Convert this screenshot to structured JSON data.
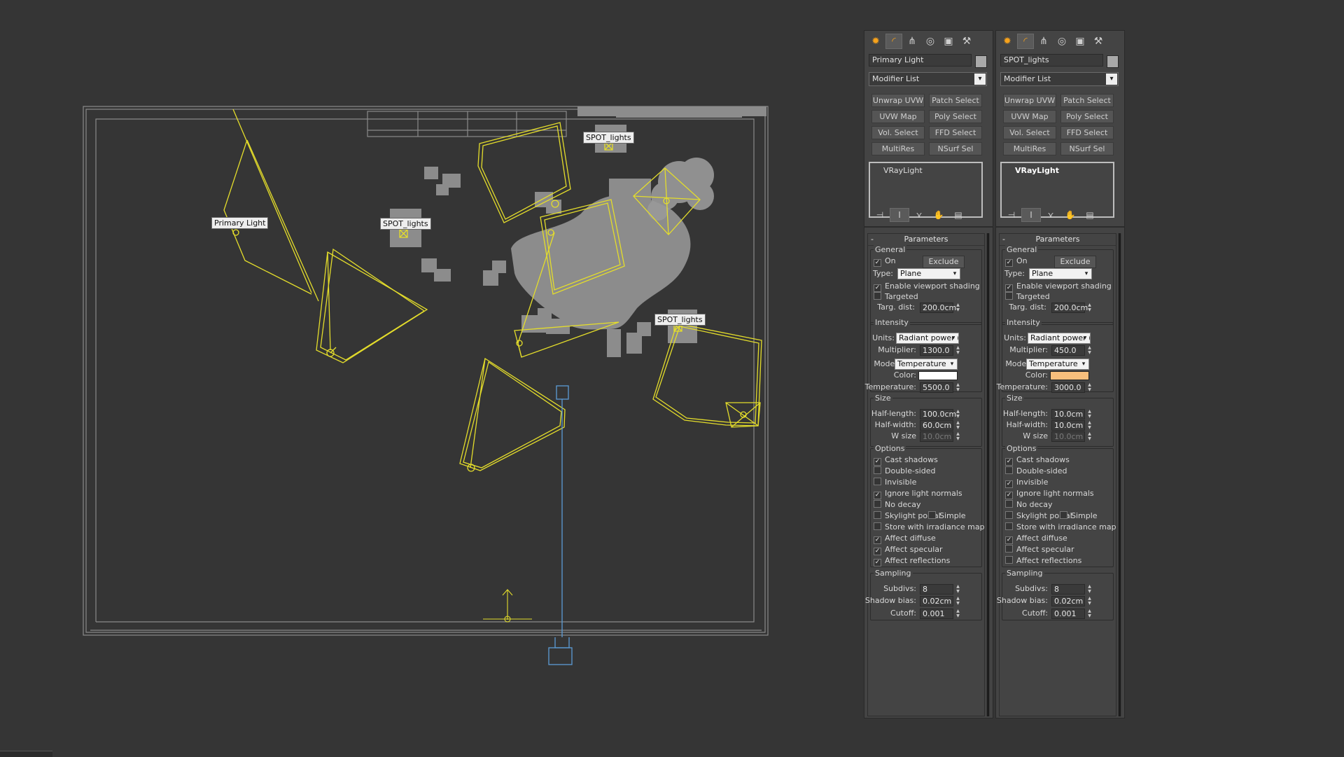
{
  "colors": {
    "background": "#353535",
    "light_wireframe": "#e4dd2b",
    "geometry_fill": "#8c8c8c",
    "camera_line": "#5b9bd5",
    "accent_orange": "#f7a21b"
  },
  "viewport": {
    "labels": {
      "primary_light": "Primary Light",
      "spot_left": "SPOT_lights",
      "spot_top": "SPOT_lights",
      "spot_right": "SPOT_lights"
    }
  },
  "command_tabs": [
    "create-icon",
    "modify-icon",
    "hierarchy-icon",
    "motion-icon",
    "display-icon",
    "utilities-icon"
  ],
  "modifier_buttons": [
    "Unwrap UVW",
    "Patch Select",
    "UVW Map",
    "Poly Select",
    "Vol. Select",
    "FFD Select",
    "MultiRes",
    "NSurf Sel"
  ],
  "panels": [
    {
      "object_name": "Primary Light",
      "modifier_list": "Modifier List",
      "stack_entry": "VRayLight",
      "stack_selected": false,
      "params_title": "Parameters",
      "collapse": "-",
      "general": {
        "title": "General",
        "on_label": "On",
        "on_checked": true,
        "exclude": "Exclude",
        "type_label": "Type:",
        "type_value": "Plane",
        "viewport_shading_label": "Enable viewport shading",
        "viewport_shading": true,
        "targeted_label": "Targeted",
        "targeted": false,
        "targ_dist_label": "Targ. dist:",
        "targ_dist": "200.0cm"
      },
      "intensity": {
        "title": "Intensity",
        "units_label": "Units:",
        "units_value": "Radiant power (W",
        "multiplier_label": "Multiplier:",
        "multiplier": "1300.0",
        "mode_label": "Mode:",
        "mode_value": "Temperature",
        "color_label": "Color:",
        "color": "#ffffff",
        "temperature_label": "Temperature:",
        "temperature": "5500.0"
      },
      "size": {
        "title": "Size",
        "half_length_label": "Half-length:",
        "half_length": "100.0cm",
        "half_width_label": "Half-width:",
        "half_width": "60.0cm",
        "w_size_label": "W size",
        "w_size": "10.0cm"
      },
      "options": {
        "title": "Options",
        "cast_shadows": "Cast shadows",
        "cast_shadows_checked": true,
        "double_sided": "Double-sided",
        "double_sided_checked": false,
        "invisible": "Invisible",
        "invisible_checked": false,
        "ignore_normals": "Ignore light normals",
        "ignore_normals_checked": true,
        "no_decay": "No decay",
        "no_decay_checked": false,
        "skylight_portal": "Skylight portal",
        "skylight_portal_checked": false,
        "simple": "Simple",
        "simple_checked": false,
        "store_irradiance": "Store with irradiance map",
        "store_irradiance_checked": false,
        "affect_diffuse": "Affect diffuse",
        "affect_diffuse_checked": true,
        "affect_specular": "Affect specular",
        "affect_specular_checked": true,
        "affect_reflections": "Affect reflections",
        "affect_reflections_checked": true
      },
      "sampling": {
        "title": "Sampling",
        "subdivs_label": "Subdivs:",
        "subdivs": "8",
        "shadow_bias_label": "Shadow bias:",
        "shadow_bias": "0.02cm",
        "cutoff_label": "Cutoff:",
        "cutoff": "0.001"
      }
    },
    {
      "object_name": "SPOT_lights",
      "modifier_list": "Modifier List",
      "stack_entry": "VRayLight",
      "stack_selected": true,
      "params_title": "Parameters",
      "collapse": "-",
      "general": {
        "title": "General",
        "on_label": "On",
        "on_checked": true,
        "exclude": "Exclude",
        "type_label": "Type:",
        "type_value": "Plane",
        "viewport_shading_label": "Enable viewport shading",
        "viewport_shading": true,
        "targeted_label": "Targeted",
        "targeted": false,
        "targ_dist_label": "Targ. dist:",
        "targ_dist": "200.0cm"
      },
      "intensity": {
        "title": "Intensity",
        "units_label": "Units:",
        "units_value": "Radiant power (W",
        "multiplier_label": "Multiplier:",
        "multiplier": "450.0",
        "mode_label": "Mode:",
        "mode_value": "Temperature",
        "color_label": "Color:",
        "color": "#f7be7c",
        "temperature_label": "Temperature:",
        "temperature": "3000.0"
      },
      "size": {
        "title": "Size",
        "half_length_label": "Half-length:",
        "half_length": "10.0cm",
        "half_width_label": "Half-width:",
        "half_width": "10.0cm",
        "w_size_label": "W size",
        "w_size": "10.0cm"
      },
      "options": {
        "title": "Options",
        "cast_shadows": "Cast shadows",
        "cast_shadows_checked": true,
        "double_sided": "Double-sided",
        "double_sided_checked": false,
        "invisible": "Invisible",
        "invisible_checked": true,
        "ignore_normals": "Ignore light normals",
        "ignore_normals_checked": true,
        "no_decay": "No decay",
        "no_decay_checked": false,
        "skylight_portal": "Skylight portal",
        "skylight_portal_checked": false,
        "simple": "Simple",
        "simple_checked": false,
        "store_irradiance": "Store with irradiance map",
        "store_irradiance_checked": false,
        "affect_diffuse": "Affect diffuse",
        "affect_diffuse_checked": true,
        "affect_specular": "Affect specular",
        "affect_specular_checked": false,
        "affect_reflections": "Affect reflections",
        "affect_reflections_checked": false
      },
      "sampling": {
        "title": "Sampling",
        "subdivs_label": "Subdivs:",
        "subdivs": "8",
        "shadow_bias_label": "Shadow bias:",
        "shadow_bias": "0.02cm",
        "cutoff_label": "Cutoff:",
        "cutoff": "0.001"
      }
    }
  ]
}
